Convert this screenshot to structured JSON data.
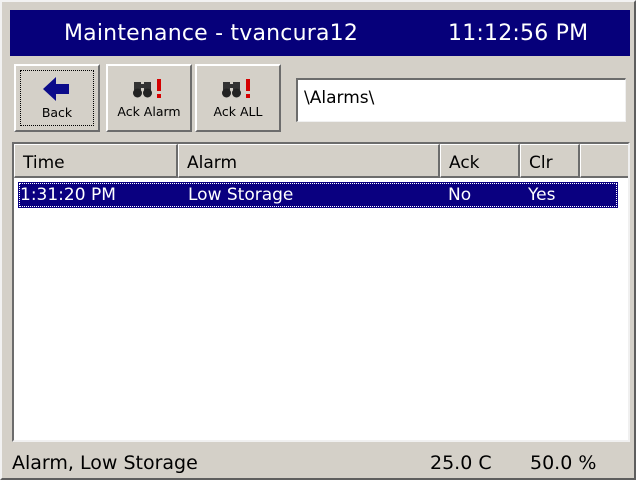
{
  "window": {
    "title": "Maintenance - tvancura12",
    "clock": "11:12:56 PM"
  },
  "toolbar": {
    "back_label": "Back",
    "ack_alarm_label": "Ack Alarm",
    "ack_all_label": "Ack ALL",
    "path_value": "\\Alarms\\"
  },
  "table": {
    "columns": [
      "Time",
      "Alarm",
      "Ack",
      "Clr",
      ""
    ],
    "rows": [
      {
        "time": "1:31:20 PM",
        "alarm": "Low Storage",
        "ack": "No",
        "clr": "Yes",
        "selected": true
      }
    ]
  },
  "status": {
    "message": "Alarm, Low Storage",
    "temperature": "25.0 C",
    "humidity": "50.0 %"
  },
  "colors": {
    "title_bar": "#06007a",
    "selection": "#0a0080",
    "alert_icon_red": "#d40000",
    "back_arrow": "#0b0b8a"
  },
  "icons": {
    "back": "arrow-left-icon",
    "ack_alarm": "binoculars-alert-icon",
    "ack_all": "binoculars-alert-icon"
  }
}
